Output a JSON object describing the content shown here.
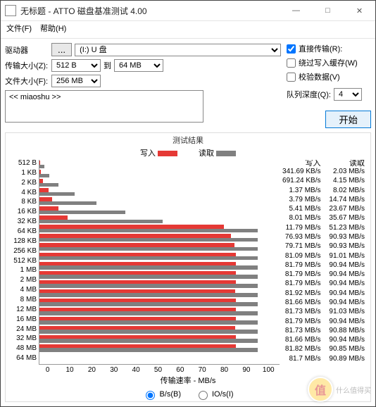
{
  "title": "无标题 - ATTO 磁盘基准测试 4.00",
  "menus": {
    "file": "文件(F)",
    "help": "帮助(H)"
  },
  "labels": {
    "drive": "驱动器",
    "browse": "...",
    "drive_val": "(I:) U 盘",
    "xfer": "传输大小(Z):",
    "from": "512 B",
    "to_word": "到",
    "to": "64 MB",
    "file": "文件大小(F):",
    "file_val": "256 MB",
    "direct": "直接传输(R):",
    "bypass": "绕过写入缓存(W)",
    "verify": "校验数据(V)",
    "queue": "队列深度(Q):",
    "queue_val": "4",
    "start": "开始",
    "desc": "<< miaoshu >>",
    "res_title": "测试结果",
    "write": "写入",
    "read": "读取",
    "xlabel": "传输速率 - MB/s",
    "unit_b": "B/s(B)",
    "unit_io": "IO/s(I)"
  },
  "colors": {
    "write": "#e53935",
    "read": "#808080"
  },
  "chart_data": {
    "type": "bar",
    "orientation": "horizontal",
    "xlabel": "传输速率 - MB/s",
    "xlim": [
      0,
      100
    ],
    "categories": [
      "512 B",
      "1 KB",
      "2 KB",
      "4 KB",
      "8 KB",
      "16 KB",
      "32 KB",
      "64 KB",
      "128 KB",
      "256 KB",
      "512 KB",
      "1 MB",
      "2 MB",
      "4 MB",
      "8 MB",
      "12 MB",
      "16 MB",
      "24 MB",
      "32 MB",
      "48 MB",
      "64 MB"
    ],
    "series": [
      {
        "name": "写入",
        "color": "#e53935",
        "units": [
          "KB/s",
          "KB/s",
          "MB/s",
          "MB/s",
          "MB/s",
          "MB/s",
          "MB/s",
          "MB/s",
          "MB/s",
          "MB/s",
          "MB/s",
          "MB/s",
          "MB/s",
          "MB/s",
          "MB/s",
          "MB/s",
          "MB/s",
          "MB/s",
          "MB/s",
          "MB/s",
          "MB/s"
        ],
        "values": [
          341.69,
          691.24,
          1.37,
          3.79,
          5.41,
          8.01,
          11.79,
          76.93,
          79.71,
          81.09,
          81.79,
          81.79,
          81.79,
          81.92,
          81.66,
          81.73,
          81.79,
          81.73,
          81.66,
          81.82,
          81.7
        ]
      },
      {
        "name": "读取",
        "color": "#808080",
        "units": [
          "MB/s",
          "MB/s",
          "MB/s",
          "MB/s",
          "MB/s",
          "MB/s",
          "MB/s",
          "MB/s",
          "MB/s",
          "MB/s",
          "MB/s",
          "MB/s",
          "MB/s",
          "MB/s",
          "MB/s",
          "MB/s",
          "MB/s",
          "MB/s",
          "MB/s",
          "MB/s",
          "MB/s"
        ],
        "values": [
          2.03,
          4.15,
          8.02,
          14.74,
          23.67,
          35.67,
          51.23,
          90.93,
          90.93,
          91.01,
          90.94,
          90.94,
          90.94,
          90.94,
          90.94,
          91.03,
          90.94,
          90.88,
          90.94,
          90.85,
          90.89
        ]
      }
    ],
    "xticks": [
      0,
      10,
      20,
      30,
      40,
      50,
      60,
      70,
      80,
      90,
      100
    ]
  },
  "watermark": "什么值得买"
}
